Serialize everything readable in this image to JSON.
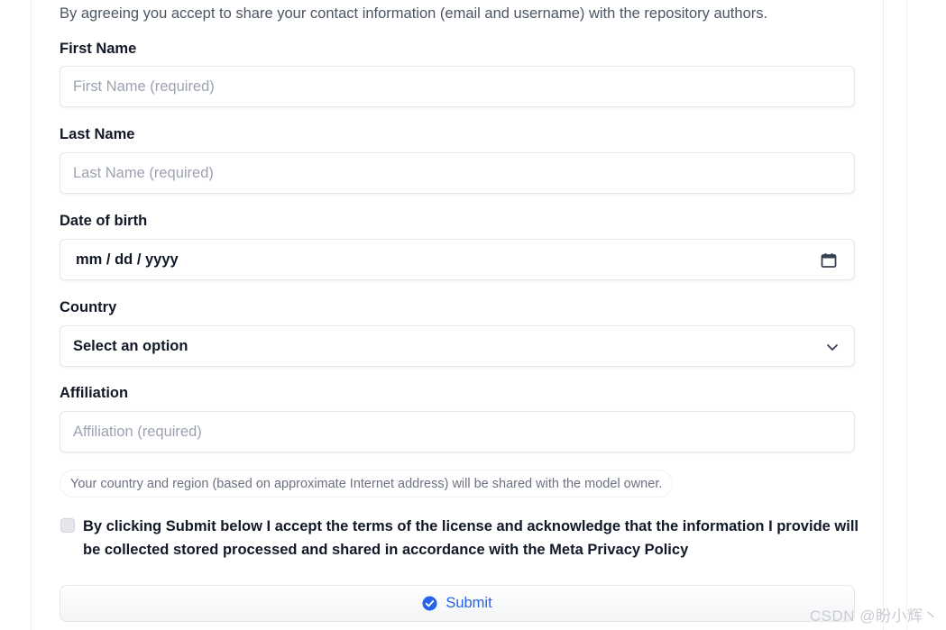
{
  "form": {
    "intro": "By agreeing you accept to share your contact information (email and username) with the repository authors.",
    "first_name": {
      "label": "First Name",
      "placeholder": "First Name (required)",
      "value": ""
    },
    "last_name": {
      "label": "Last Name",
      "placeholder": "Last Name (required)",
      "value": ""
    },
    "dob": {
      "label": "Date of birth",
      "display": "mm / dd / yyyy",
      "icon": "calendar-icon"
    },
    "country": {
      "label": "Country",
      "selected": "Select an option",
      "icon": "chevron-down-icon"
    },
    "affiliation": {
      "label": "Affiliation",
      "placeholder": "Affiliation (required)",
      "value": ""
    },
    "notice": "Your country and region (based on approximate Internet address) will be shared with the model owner.",
    "terms": {
      "checked": false,
      "text": "By clicking Submit below I accept the terms of the license and acknowledge that the information I provide will be collected stored processed and shared in accordance with the Meta Privacy Policy"
    },
    "submit": {
      "label": "Submit",
      "icon": "check-circle-icon"
    }
  },
  "watermark": "CSDN @盼小辉丶",
  "colors": {
    "accent": "#2563eb",
    "label": "#111827",
    "muted": "#6b7280",
    "placeholder": "#9ca3af",
    "border": "#e5e7eb"
  }
}
